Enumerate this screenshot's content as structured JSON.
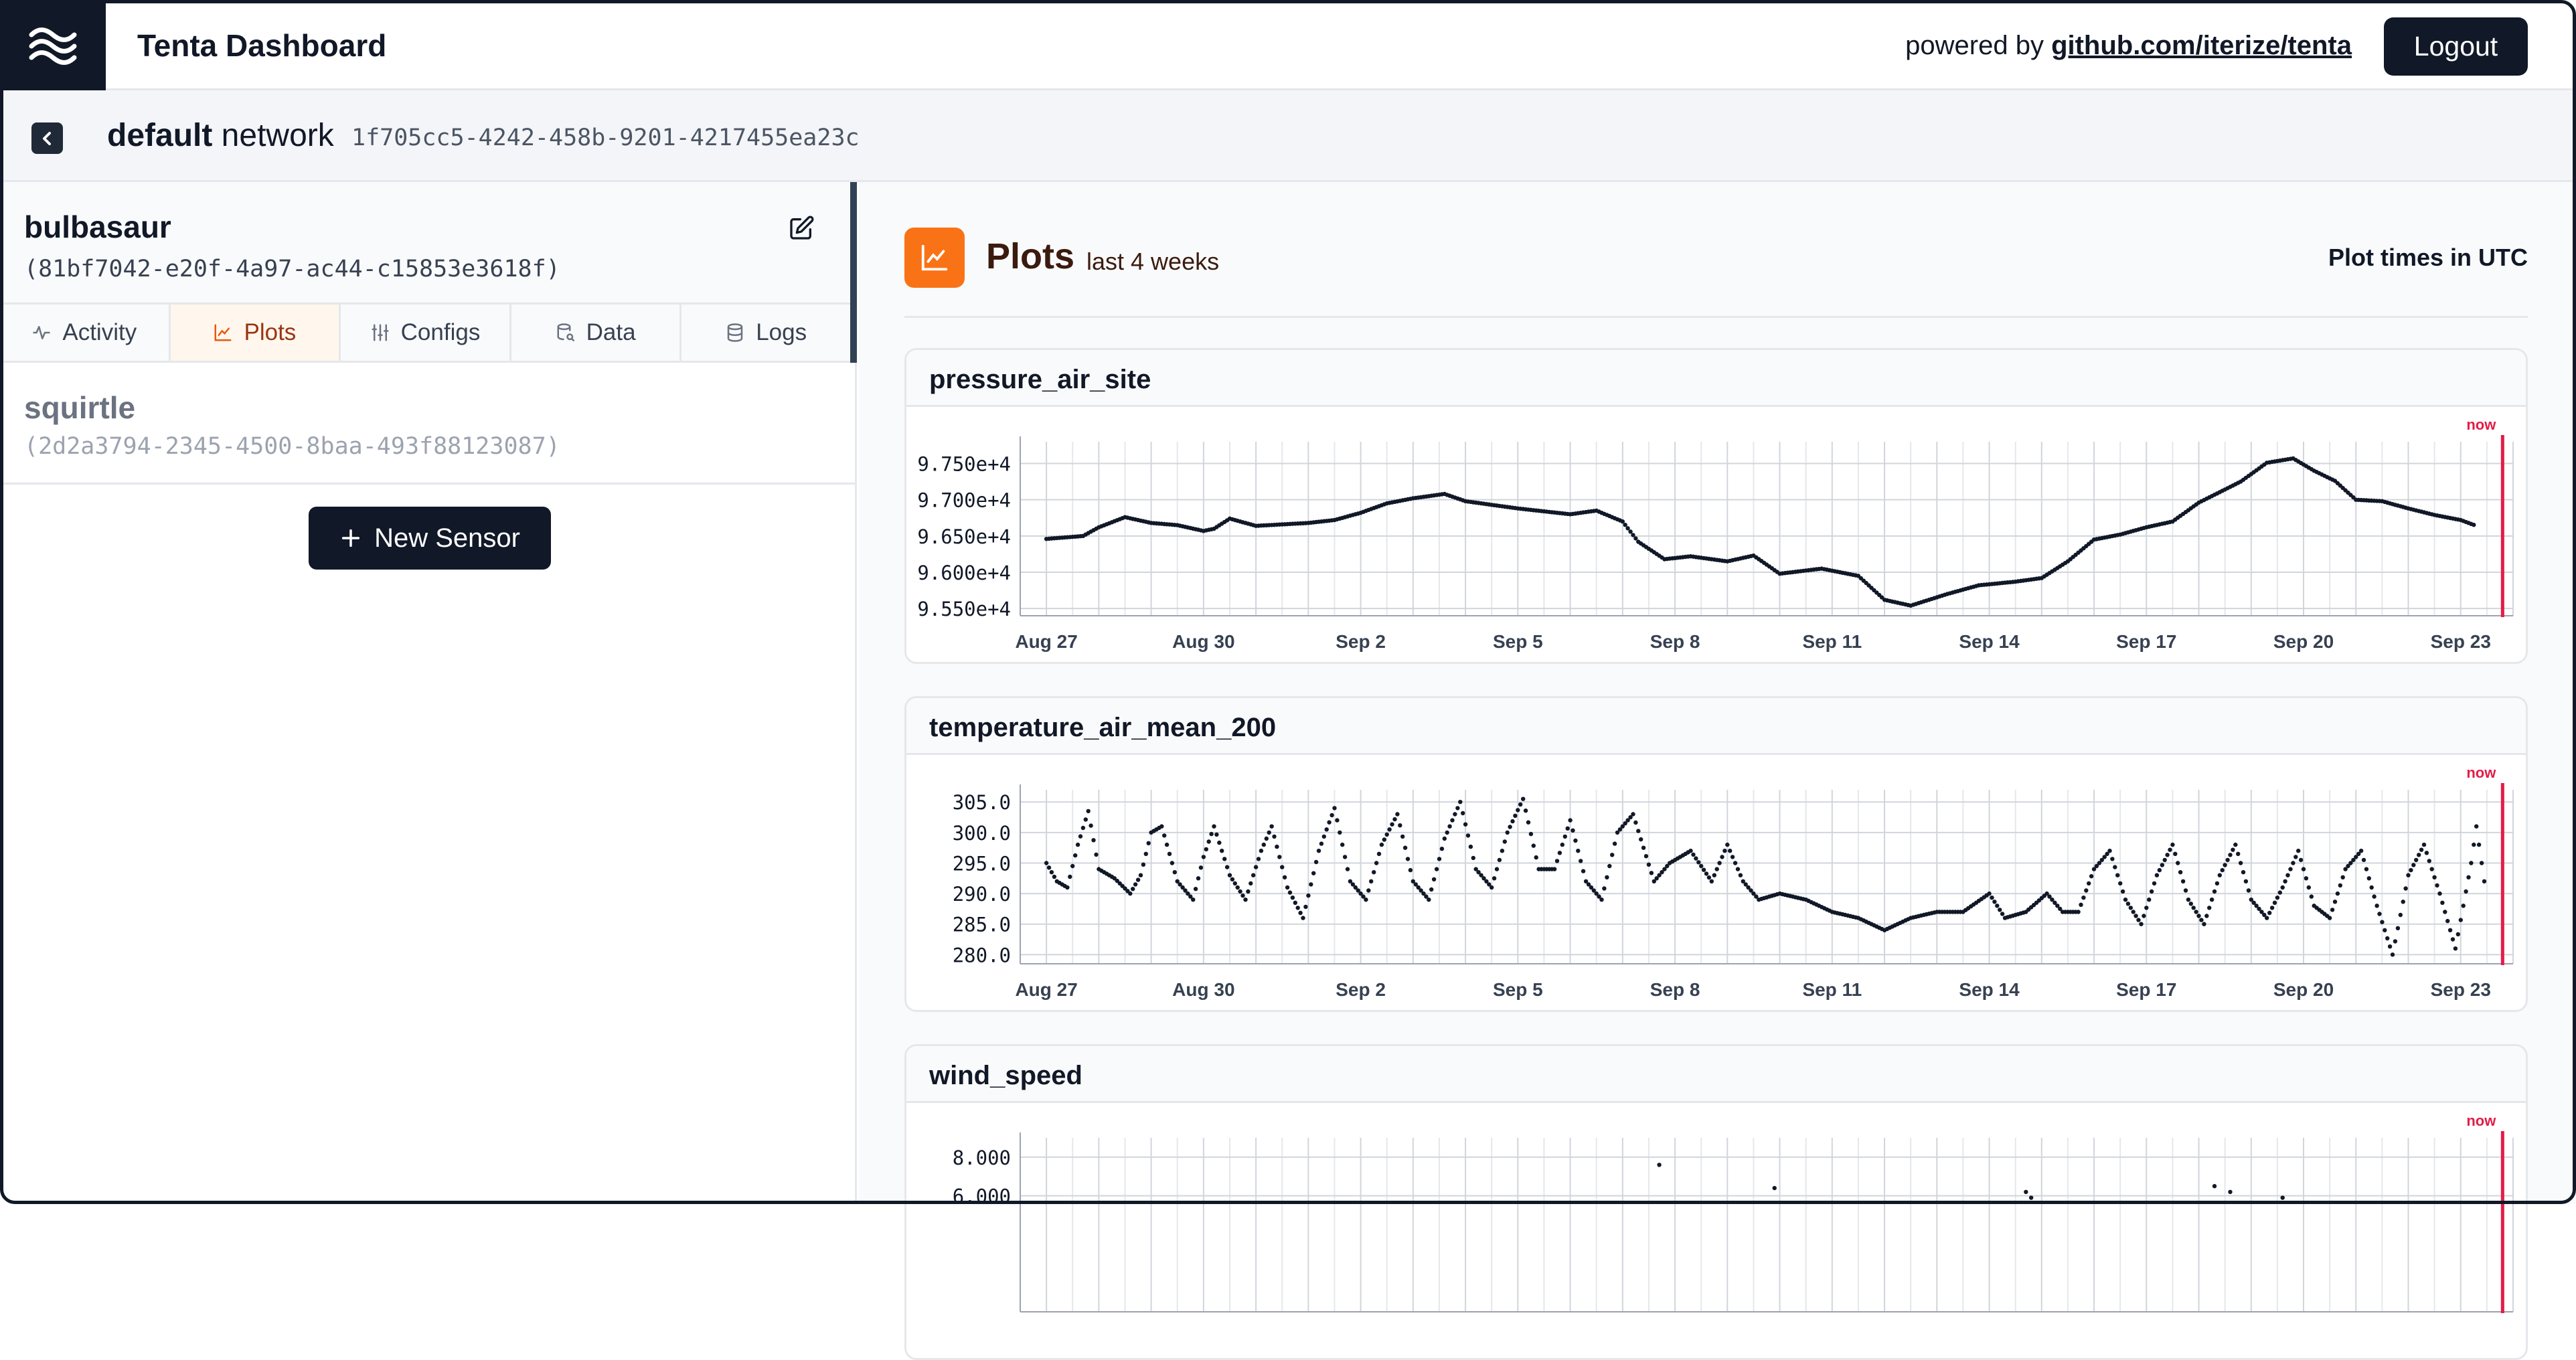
{
  "header": {
    "app_title": "Tenta Dashboard",
    "powered_prefix": "powered by ",
    "powered_link": "github.com/iterize/tenta",
    "logout_label": "Logout"
  },
  "network": {
    "name": "default",
    "suffix": " network",
    "id": "1f705cc5-4242-458b-9201-4217455ea23c"
  },
  "sensors": [
    {
      "name": "bulbasaur",
      "id": "(81bf7042-e20f-4a97-ac44-c15853e3618f)"
    },
    {
      "name": "squirtle",
      "id": "(2d2a3794-2345-4500-8baa-493f88123087)"
    }
  ],
  "tabs": [
    {
      "label": "Activity",
      "icon": "activity-icon"
    },
    {
      "label": "Plots",
      "icon": "chart-icon",
      "active": true
    },
    {
      "label": "Configs",
      "icon": "sliders-icon"
    },
    {
      "label": "Data",
      "icon": "database-search-icon"
    },
    {
      "label": "Logs",
      "icon": "database-icon"
    }
  ],
  "new_sensor_label": "New Sensor",
  "plots": {
    "title": "Plots",
    "subtitle": "last 4 weeks",
    "times_note": "Plot times in UTC",
    "now_label": "now"
  },
  "colors": {
    "accent": "#f97316",
    "dark": "#111827",
    "now_line": "#e11d48"
  },
  "chart_data": [
    {
      "type": "scatter",
      "title": "pressure_air_site",
      "x_ticks": [
        "Aug 27",
        "Aug 30",
        "Sep 2",
        "Sep 5",
        "Sep 8",
        "Sep 11",
        "Sep 14",
        "Sep 17",
        "Sep 20",
        "Sep 23"
      ],
      "y_ticks": [
        "9.750e+4",
        "9.700e+4",
        "9.650e+4",
        "9.600e+4",
        "9.550e+4"
      ],
      "ylim": [
        95400,
        97800
      ],
      "x_range_days": [
        -0.5,
        28
      ],
      "now_day": 27.8,
      "keypoints": [
        [
          0,
          96460
        ],
        [
          0.7,
          96500
        ],
        [
          1,
          96620
        ],
        [
          1.5,
          96760
        ],
        [
          2,
          96680
        ],
        [
          2.5,
          96650
        ],
        [
          3,
          96570
        ],
        [
          3.2,
          96600
        ],
        [
          3.5,
          96740
        ],
        [
          4,
          96640
        ],
        [
          5,
          96680
        ],
        [
          5.5,
          96720
        ],
        [
          6,
          96820
        ],
        [
          6.5,
          96950
        ],
        [
          7,
          97020
        ],
        [
          7.6,
          97080
        ],
        [
          8,
          96980
        ],
        [
          9,
          96880
        ],
        [
          10,
          96800
        ],
        [
          10.5,
          96850
        ],
        [
          11,
          96700
        ],
        [
          11.3,
          96420
        ],
        [
          11.8,
          96180
        ],
        [
          12.3,
          96220
        ],
        [
          13,
          96150
        ],
        [
          13.5,
          96230
        ],
        [
          14,
          95980
        ],
        [
          14.8,
          96050
        ],
        [
          15.5,
          95950
        ],
        [
          16,
          95620
        ],
        [
          16.5,
          95540
        ],
        [
          17.2,
          95700
        ],
        [
          17.8,
          95820
        ],
        [
          18.5,
          95870
        ],
        [
          19,
          95920
        ],
        [
          19.5,
          96150
        ],
        [
          20,
          96450
        ],
        [
          20.5,
          96520
        ],
        [
          21,
          96620
        ],
        [
          21.5,
          96700
        ],
        [
          22,
          96960
        ],
        [
          22.8,
          97250
        ],
        [
          23.3,
          97510
        ],
        [
          23.8,
          97570
        ],
        [
          24.2,
          97400
        ],
        [
          24.6,
          97260
        ],
        [
          25,
          97000
        ],
        [
          25.5,
          96980
        ],
        [
          26,
          96880
        ],
        [
          26.5,
          96790
        ],
        [
          27,
          96720
        ],
        [
          27.3,
          96640
        ]
      ]
    },
    {
      "type": "scatter",
      "title": "temperature_air_mean_200",
      "x_ticks": [
        "Aug 27",
        "Aug 30",
        "Sep 2",
        "Sep 5",
        "Sep 8",
        "Sep 11",
        "Sep 14",
        "Sep 17",
        "Sep 20",
        "Sep 23"
      ],
      "y_ticks": [
        "305.0",
        "300.0",
        "295.0",
        "290.0",
        "285.0",
        "280.0"
      ],
      "ylim": [
        278.5,
        307
      ],
      "x_range_days": [
        -0.5,
        28
      ],
      "now_day": 27.8,
      "keypoints": [
        [
          0,
          295
        ],
        [
          0.2,
          292
        ],
        [
          0.4,
          291
        ],
        [
          0.6,
          298
        ],
        [
          0.8,
          303.5
        ],
        [
          1,
          294
        ],
        [
          1.3,
          292.5
        ],
        [
          1.6,
          290
        ],
        [
          1.8,
          293
        ],
        [
          2,
          300
        ],
        [
          2.2,
          301
        ],
        [
          2.5,
          292
        ],
        [
          2.8,
          289
        ],
        [
          3,
          296
        ],
        [
          3.2,
          301
        ],
        [
          3.5,
          293
        ],
        [
          3.8,
          289
        ],
        [
          4.1,
          297
        ],
        [
          4.3,
          301
        ],
        [
          4.6,
          291
        ],
        [
          4.9,
          286
        ],
        [
          5.2,
          297
        ],
        [
          5.5,
          304
        ],
        [
          5.8,
          292
        ],
        [
          6.1,
          289
        ],
        [
          6.4,
          298
        ],
        [
          6.7,
          303
        ],
        [
          7,
          292
        ],
        [
          7.3,
          289
        ],
        [
          7.6,
          299
        ],
        [
          7.9,
          305
        ],
        [
          8.2,
          294
        ],
        [
          8.5,
          291
        ],
        [
          8.8,
          300
        ],
        [
          9.1,
          305.5
        ],
        [
          9.4,
          294
        ],
        [
          9.7,
          294
        ],
        [
          10,
          302
        ],
        [
          10.3,
          292
        ],
        [
          10.6,
          289
        ],
        [
          10.9,
          300
        ],
        [
          11.2,
          303
        ],
        [
          11.6,
          292
        ],
        [
          11.9,
          295
        ],
        [
          12.3,
          297
        ],
        [
          12.7,
          292
        ],
        [
          13,
          298
        ],
        [
          13.3,
          292
        ],
        [
          13.6,
          289
        ],
        [
          14,
          290
        ],
        [
          14.5,
          289
        ],
        [
          15,
          287
        ],
        [
          15.5,
          286
        ],
        [
          16,
          284
        ],
        [
          16.5,
          286
        ],
        [
          17,
          287
        ],
        [
          17.5,
          287
        ],
        [
          18,
          290
        ],
        [
          18.3,
          286
        ],
        [
          18.7,
          287
        ],
        [
          19.1,
          290
        ],
        [
          19.4,
          287
        ],
        [
          19.7,
          287
        ],
        [
          20,
          294
        ],
        [
          20.3,
          297
        ],
        [
          20.6,
          289
        ],
        [
          20.9,
          285
        ],
        [
          21.2,
          293
        ],
        [
          21.5,
          298
        ],
        [
          21.8,
          289
        ],
        [
          22.1,
          285
        ],
        [
          22.4,
          293
        ],
        [
          22.7,
          298
        ],
        [
          23,
          289
        ],
        [
          23.3,
          286
        ],
        [
          23.6,
          291
        ],
        [
          23.9,
          297
        ],
        [
          24.2,
          288
        ],
        [
          24.5,
          286
        ],
        [
          24.8,
          294
        ],
        [
          25.1,
          297
        ],
        [
          25.4,
          288
        ],
        [
          25.7,
          280
        ],
        [
          26,
          293
        ],
        [
          26.3,
          298
        ],
        [
          26.6,
          290
        ],
        [
          26.9,
          281
        ],
        [
          27.2,
          295
        ],
        [
          27.3,
          301
        ],
        [
          27.5,
          289
        ]
      ]
    },
    {
      "type": "scatter",
      "title": "wind_speed",
      "x_ticks": [],
      "y_ticks": [
        "8.000",
        "6.000"
      ],
      "ylim": [
        0,
        9
      ],
      "x_range_days": [
        -0.5,
        28
      ],
      "now_day": 27.8,
      "keypoints": [
        [
          11.7,
          7.6
        ],
        [
          13.9,
          6.4
        ],
        [
          18.7,
          6.2
        ],
        [
          18.8,
          5.9
        ],
        [
          22.3,
          6.5
        ],
        [
          22.6,
          6.2
        ],
        [
          23.6,
          5.9
        ]
      ]
    }
  ]
}
